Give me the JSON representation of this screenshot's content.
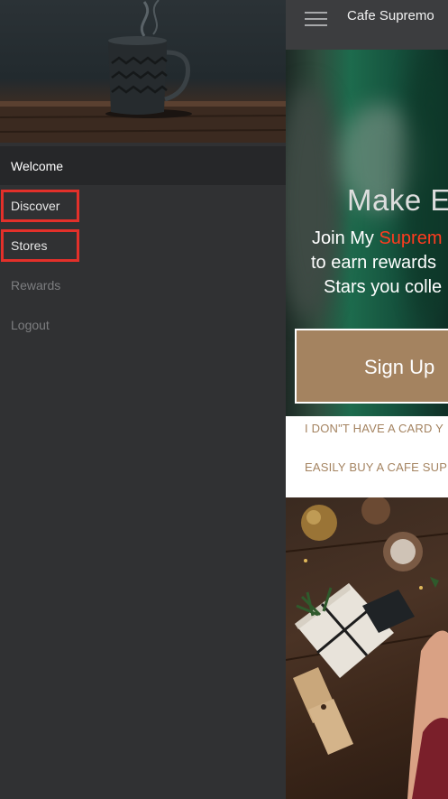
{
  "app": {
    "title": "Cafe Supremo"
  },
  "drawer": {
    "header": "Welcome",
    "items": [
      {
        "label": "Discover",
        "highlighted": true,
        "dimmed": false
      },
      {
        "label": "Stores",
        "highlighted": true,
        "dimmed": false
      },
      {
        "label": "Rewards",
        "highlighted": false,
        "dimmed": true
      },
      {
        "label": "Logout",
        "highlighted": false,
        "dimmed": true
      }
    ]
  },
  "promo": {
    "headline": "Make E",
    "line1_start": "Join My ",
    "line1_accent": "Suprem",
    "line2": "to earn rewards",
    "line3": "Stars you colle",
    "signup_label": "Sign Up"
  },
  "links": {
    "no_card": "I DON\"T HAVE A CARD Y",
    "buy_card": "EASILY BUY A CAFE SUP"
  },
  "colors": {
    "drawer_bg": "#303133",
    "highlight_box": "#e3302a",
    "accent_brown": "#a48360",
    "accent_red": "#ff3b1f"
  },
  "icons": {
    "menu": "hamburger-menu-icon"
  }
}
